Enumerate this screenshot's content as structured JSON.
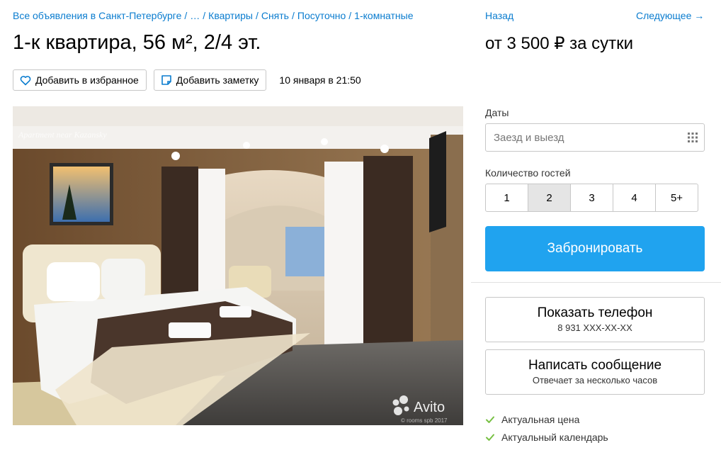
{
  "breadcrumb": {
    "items": [
      "Все объявления в Санкт-Петербурге",
      "…",
      "Квартиры",
      "Снять",
      "Посуточно",
      "1-комнатные"
    ]
  },
  "listing": {
    "title": "1-к квартира, 56 м², 2/4 эт.",
    "favorite_label": "Добавить в избранное",
    "note_label": "Добавить заметку",
    "date_published": "10 января в 21:50"
  },
  "gallery": {
    "watermark_text": "Apartment near Kazansky",
    "brand_text": "Avito",
    "copyright_text": "© rooms spb 2017"
  },
  "nav": {
    "back": "Назад",
    "next": "Следующее →"
  },
  "price": {
    "text": "от 3 500 ₽ за сутки"
  },
  "booking": {
    "dates_label": "Даты",
    "dates_placeholder": "Заезд и выезд",
    "guests_label": "Количество гостей",
    "guests_options": [
      "1",
      "2",
      "3",
      "4",
      "5+"
    ],
    "guests_selected": "2",
    "book_label": "Забронировать"
  },
  "contact": {
    "phone_label": "Показать телефон",
    "phone_number": "8 931 XXX-XX-XX",
    "message_label": "Написать сообщение",
    "message_sub": "Отвечает за несколько часов"
  },
  "features": [
    "Актуальная цена",
    "Актуальный календарь"
  ],
  "colors": {
    "link": "#0a7ccf",
    "primary_button": "#20a3ef",
    "check": "#77c043"
  }
}
